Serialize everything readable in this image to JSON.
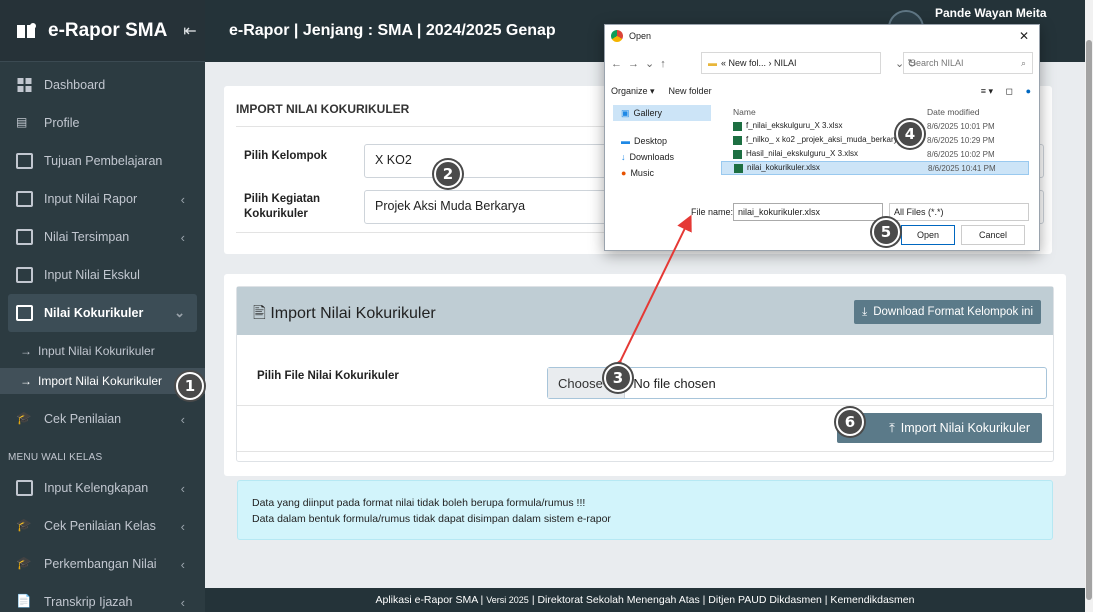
{
  "sidebar": {
    "brand": "e-Rapor SMA",
    "items": [
      {
        "label": "Dashboard"
      },
      {
        "label": "Profile"
      },
      {
        "label": "Tujuan Pembelajaran"
      },
      {
        "label": "Input Nilai Rapor"
      },
      {
        "label": "Nilai Tersimpan"
      },
      {
        "label": "Input Nilai Ekskul"
      },
      {
        "label": "Nilai Kokurikuler"
      },
      {
        "label": "Input Nilai Kokurikuler"
      },
      {
        "label": "Import Nilai Kokurikuler"
      },
      {
        "label": "Cek Penilaian"
      },
      {
        "label": "Input Kelengkapan"
      },
      {
        "label": "Cek Penilaian Kelas"
      },
      {
        "label": "Perkembangan Nilai"
      },
      {
        "label": "Transkrip Ijazah"
      }
    ],
    "section_header": "MENU WALI KELAS"
  },
  "topbar": {
    "title": "e-Rapor | Jenjang : SMA | 2024/2025 Genap",
    "user": "Pande Wayan Meita"
  },
  "card1": {
    "header": "IMPORT NILAI KOKURIKULER",
    "kelompok_label": "Pilih Kelompok",
    "kelompok_value": "X KO2",
    "kegiatan_label": "Pilih Kegiatan Kokurikuler",
    "kegiatan_value": "Projek Aksi Muda Berkarya"
  },
  "card2": {
    "title": "Import Nilai Kokurikuler",
    "download_btn": "Download Format Kelompok ini",
    "file_label": "Pilih File Nilai Kokurikuler",
    "choose_file": "Choose F",
    "no_file": "No file chosen",
    "import_btn": "Import Nilai Kokurikuler"
  },
  "info": {
    "line1": "Data yang diinput pada format nilai tidak boleh berupa formula/rumus !!!",
    "line2": "Data dalam bentuk formula/rumus tidak dapat disimpan dalam sistem e-rapor"
  },
  "footer": {
    "app": "Aplikasi e-Rapor SMA |",
    "version": "Versi 2025",
    "rest": "| Direktorat Sekolah Menengah Atas | Ditjen PAUD Dikdasmen | Kemendikdasmen"
  },
  "dialog": {
    "title": "Open",
    "path": "« New fol... › NILAI",
    "search_placeholder": "Search NILAI",
    "organize": "Organize ▾",
    "new_folder": "New folder",
    "left_items": [
      "Gallery",
      "Desktop",
      "Downloads",
      "Music"
    ],
    "col_name": "Name",
    "col_date": "Date modified",
    "files": [
      {
        "name": "f_nilai_ekskulguru_X 3.xlsx",
        "date": "8/6/2025 10:01 PM"
      },
      {
        "name": "f_nilko_ x ko2 _projek_aksi_muda_berkarya",
        "date": "8/6/2025 10:29 PM"
      },
      {
        "name": "Hasil_nilai_ekskulguru_X 3.xlsx",
        "date": "8/6/2025 10:02 PM"
      },
      {
        "name": "nilai_kokurikuler.xlsx",
        "date": "8/6/2025 10:41 PM"
      }
    ],
    "file_name_label": "File name:",
    "file_name_value": "nilai_kokurikuler.xlsx",
    "file_type": "All Files (*.*)",
    "open_btn": "Open",
    "cancel_btn": "Cancel"
  },
  "steps": [
    "1",
    "2",
    "3",
    "4",
    "5",
    "6"
  ],
  "colors": {
    "sidebar": "#2c3b41",
    "accent": "#5b7a89",
    "info_bg": "#d2f4fb",
    "arrow": "#e53935"
  }
}
